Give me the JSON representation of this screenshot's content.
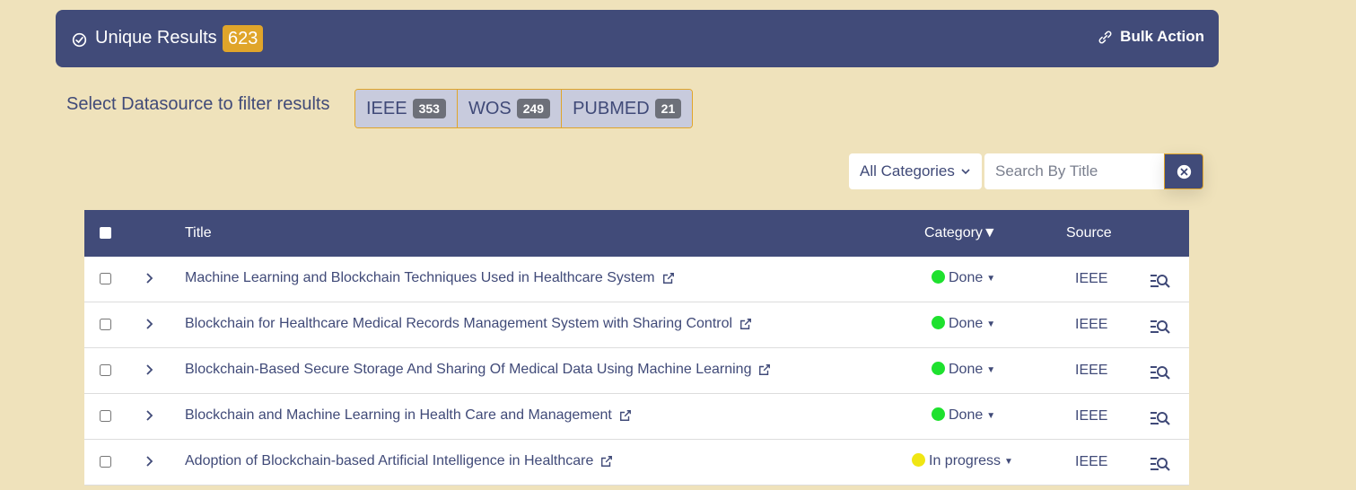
{
  "header": {
    "title": "Unique Results",
    "count": "623",
    "bulk_action": "Bulk Action"
  },
  "filter": {
    "label": "Select Datasource to filter results",
    "sources": [
      {
        "name": "IEEE",
        "count": "353"
      },
      {
        "name": "WOS",
        "count": "249"
      },
      {
        "name": "PUBMED",
        "count": "21"
      }
    ]
  },
  "controls": {
    "category_select": "All Categories",
    "search_placeholder": "Search By Title"
  },
  "table": {
    "headers": {
      "title": "Title",
      "category": "Category▼",
      "source": "Source"
    },
    "rows": [
      {
        "title": "Machine Learning and Blockchain Techniques Used in Healthcare System",
        "status": "Done",
        "source": "IEEE"
      },
      {
        "title": "Blockchain for Healthcare Medical Records Management System with Sharing Control",
        "status": "Done",
        "source": "IEEE"
      },
      {
        "title": "Blockchain-Based Secure Storage And Sharing Of Medical Data Using Machine Learning",
        "status": "Done",
        "source": "IEEE"
      },
      {
        "title": "Blockchain and Machine Learning in Health Care and Management",
        "status": "Done",
        "source": "IEEE"
      },
      {
        "title": "Adoption of Blockchain-based Artificial Intelligence in Healthcare",
        "status": "In progress",
        "source": "IEEE"
      }
    ]
  },
  "colors": {
    "header_bg": "#414b79",
    "badge_orange": "#e0a52a",
    "done": "#1ee12e",
    "in_progress": "#f0e613",
    "page_bg": "#efe2bb"
  }
}
